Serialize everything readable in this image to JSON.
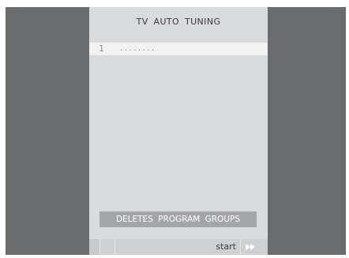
{
  "menu": {
    "title": "TV AUTO TUNING",
    "rows": [
      {
        "number": "1",
        "value": "........"
      }
    ],
    "deletes_label": "DELETES PROGRAM GROUPS"
  },
  "bottom_bar": {
    "start_label": "start",
    "forward_icon": "fast-forward-icon"
  },
  "colors": {
    "frame": "#6b6c6e",
    "menu_background": "#dadbdc",
    "row_highlight": "#f2f2f3",
    "button_background": "#a4a5a8",
    "button_text": "#ffffff",
    "text": "#3a3a3c",
    "dim_text": "#8b8c8f"
  }
}
